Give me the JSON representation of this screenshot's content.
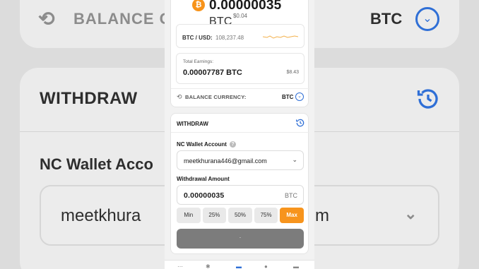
{
  "background": {
    "balance_currency_label": "BALANCE C",
    "balance_currency_value": "BTC",
    "withdraw_title": "WITHDRAW",
    "wallet_account_label": "NC Wallet Acco",
    "email_left": "meetkhura",
    "email_right": "m"
  },
  "balance": {
    "amount": "0.00000035",
    "unit": "BTC",
    "usd": "$0.04",
    "pair_label": "BTC / USD:",
    "pair_value": "108,237.48",
    "earnings_label": "Total Earnings:",
    "earnings_value": "0.00007787 BTC",
    "earnings_usd": "$8.43",
    "currency_label": "BALANCE CURRENCY:",
    "currency_value": "BTC"
  },
  "withdraw": {
    "title": "WITHDRAW",
    "account_label": "NC Wallet Account",
    "account_value": "meetkhurana446@gmail.com",
    "amount_label": "Withdrawal Amount",
    "amount_value": "0.00000035",
    "amount_unit": "BTC",
    "percent_buttons": [
      "Min",
      "25%",
      "50%",
      "75%",
      "Max"
    ],
    "submit_label": "·"
  },
  "colors": {
    "accent_orange": "#f7941d",
    "accent_blue": "#2f6fd6",
    "bitcoin_orange": "#f7931a"
  },
  "icons": {
    "coin": "bitcoin-icon",
    "history": "history-icon",
    "currency": "currency-exchange-icon",
    "dropdown": "chevron-down-icon"
  }
}
